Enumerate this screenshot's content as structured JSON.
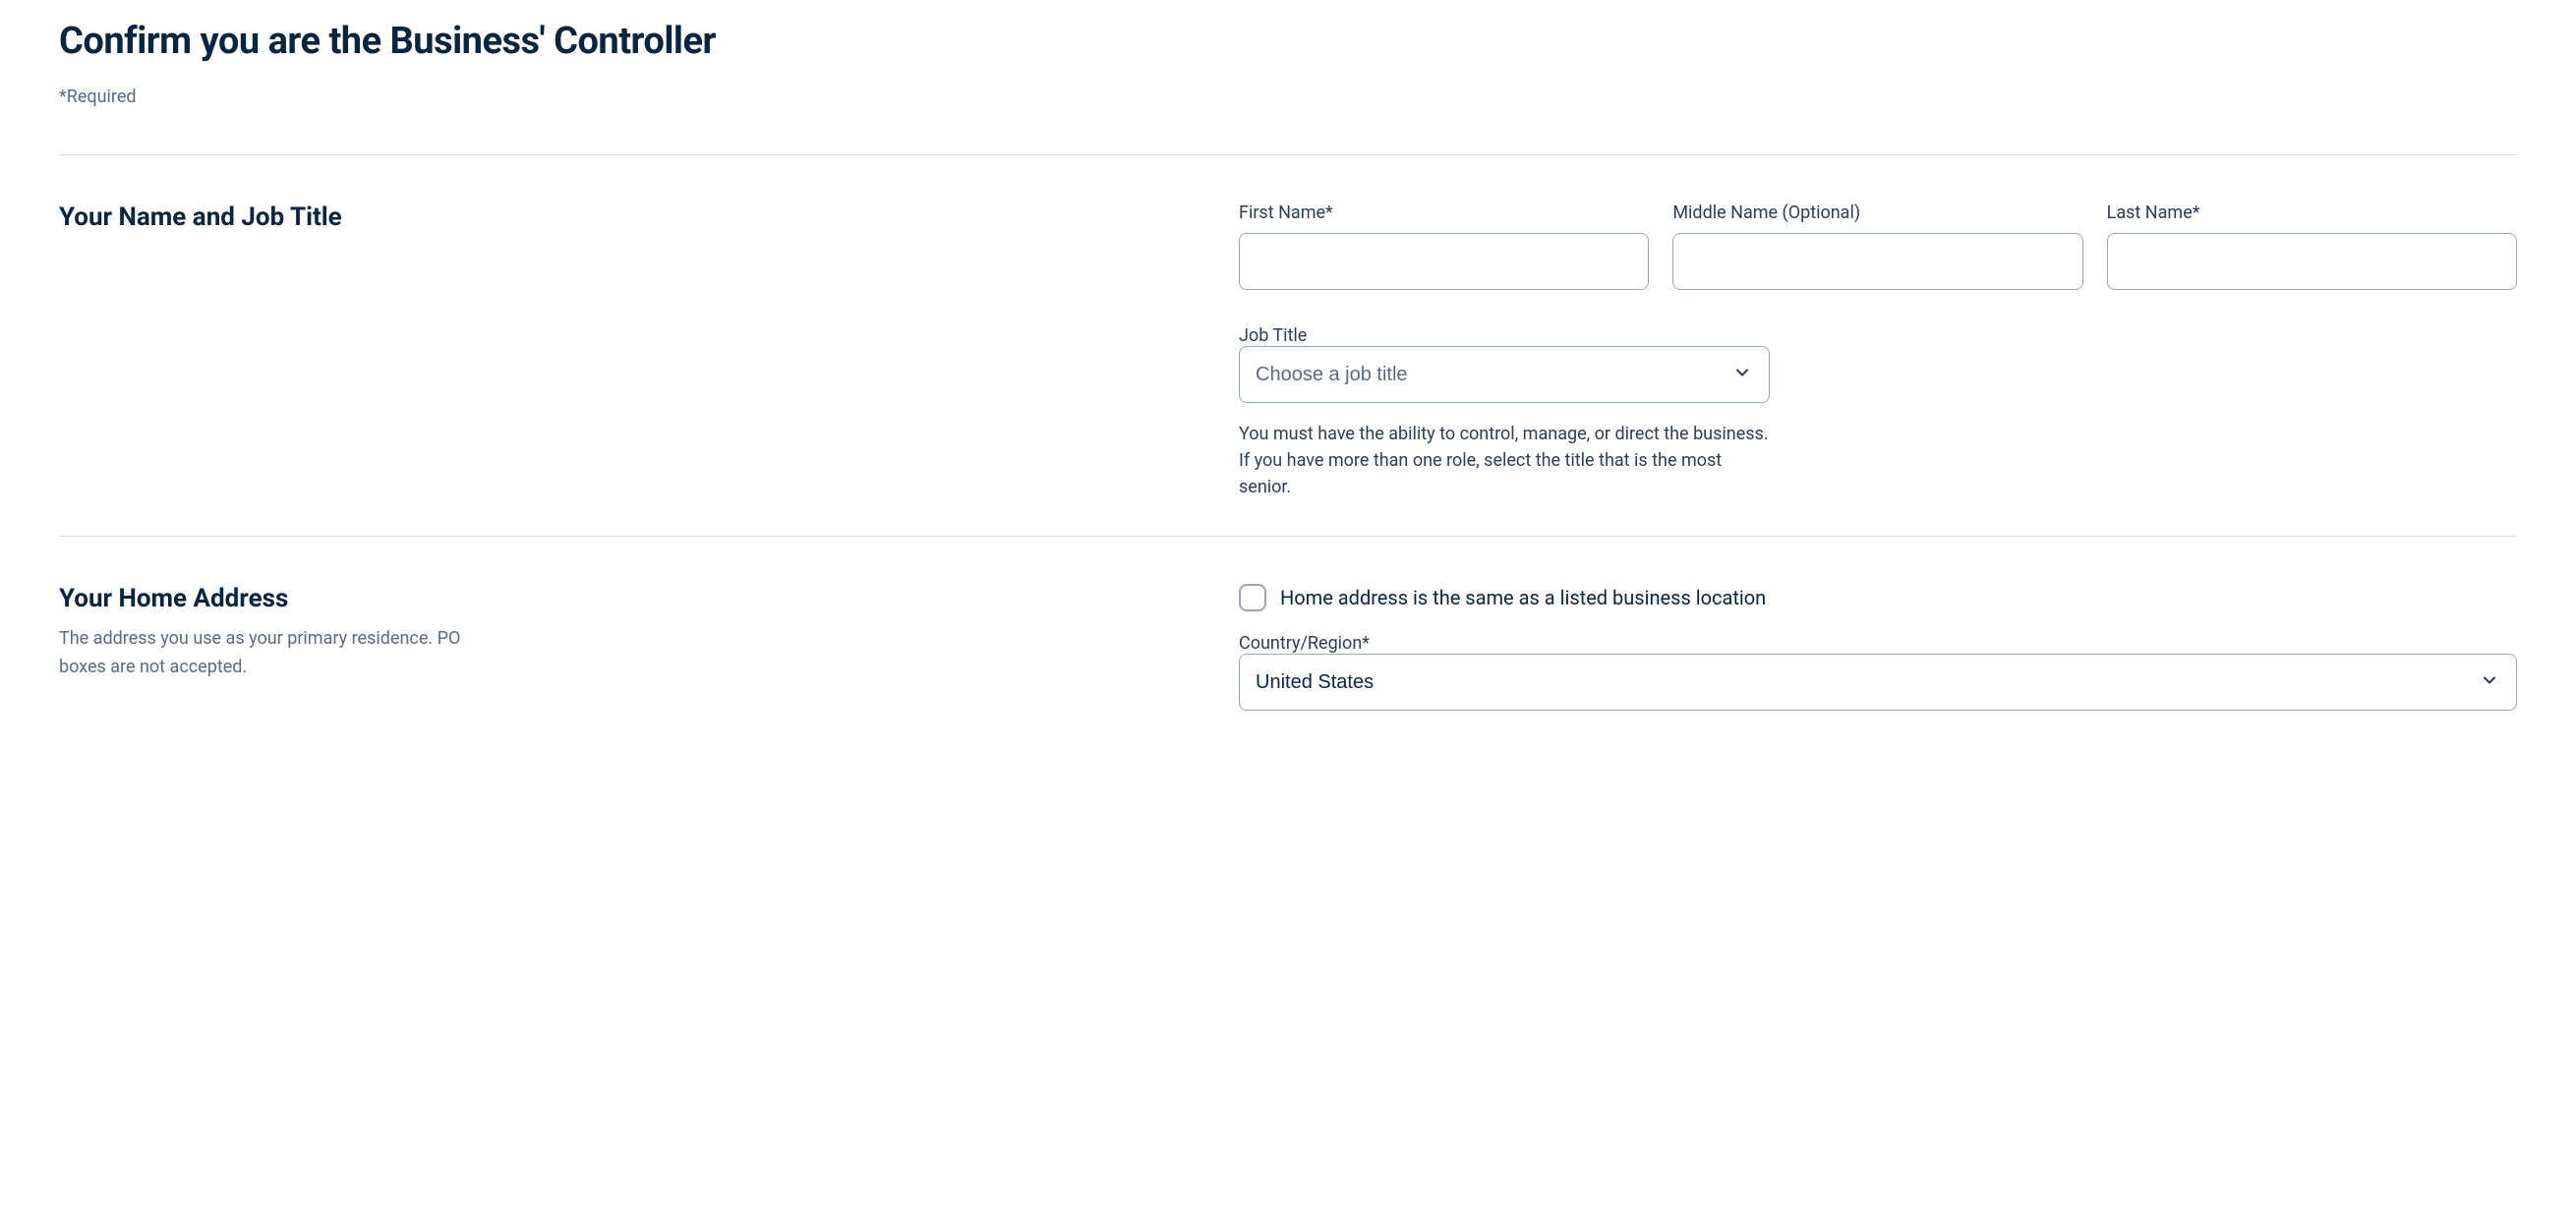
{
  "header": {
    "title": "Confirm you are the Business' Controller",
    "required_note": "*Required"
  },
  "name_section": {
    "heading": "Your Name and Job Title",
    "first_name_label": "First Name*",
    "middle_name_label": "Middle Name (Optional)",
    "last_name_label": "Last Name*",
    "first_name_value": "",
    "middle_name_value": "",
    "last_name_value": "",
    "job_title_label": "Job Title",
    "job_title_placeholder": "Choose a job title",
    "job_title_helper": "You must have the ability to control, manage, or direct the business. If you have more than one role, select the title that is the most senior."
  },
  "address_section": {
    "heading": "Your Home Address",
    "description": "The address you use as your primary residence. PO boxes are not accepted.",
    "same_address_label": "Home address is the same as a listed business location",
    "same_address_checked": false,
    "country_label": "Country/Region*",
    "country_value": "United States"
  }
}
